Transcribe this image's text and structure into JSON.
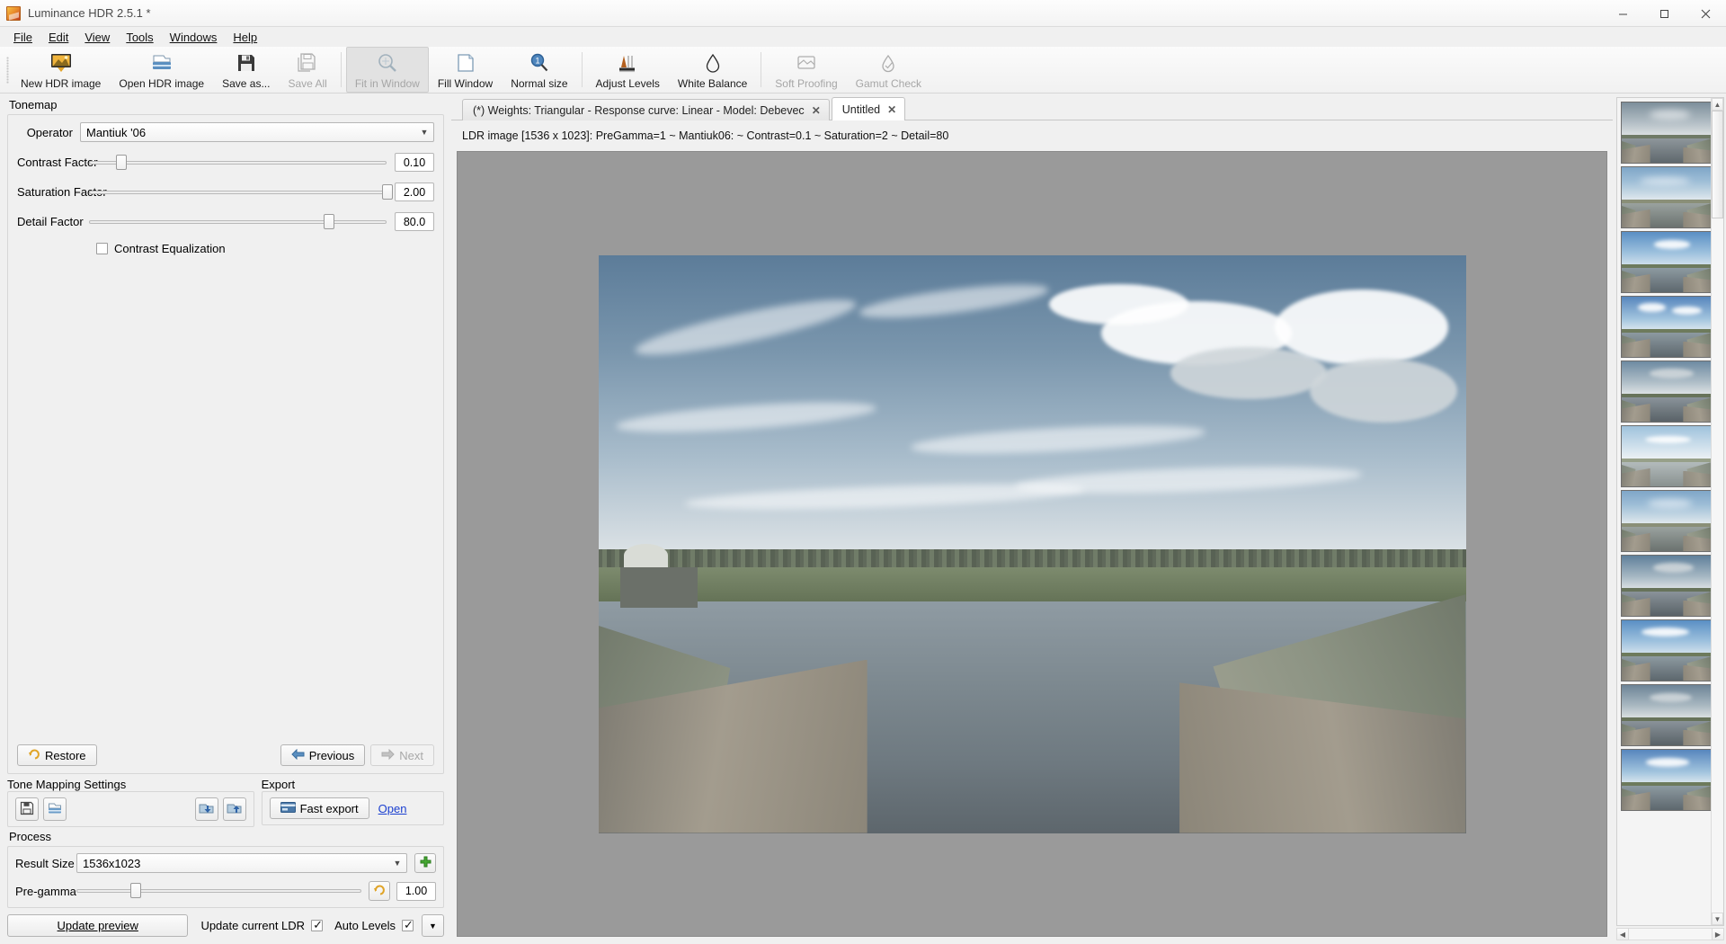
{
  "window": {
    "title": "Luminance HDR 2.5.1 *",
    "icon": "app-icon",
    "buttons": {
      "minimize": "—",
      "maximize": "❐",
      "close": "✕"
    }
  },
  "menubar": {
    "items": [
      {
        "label": "File",
        "mnemonic": "F"
      },
      {
        "label": "Edit",
        "mnemonic": "E"
      },
      {
        "label": "View",
        "mnemonic": "V"
      },
      {
        "label": "Tools",
        "mnemonic": "T"
      },
      {
        "label": "Windows",
        "mnemonic": "W"
      },
      {
        "label": "Help",
        "mnemonic": "H"
      }
    ]
  },
  "toolbar": {
    "buttons": [
      {
        "label": "New HDR image",
        "icon": "new-hdr-icon",
        "enabled": true,
        "checked": false
      },
      {
        "label": "Open HDR image",
        "icon": "open-folder-icon",
        "enabled": true,
        "checked": false
      },
      {
        "label": "Save as...",
        "icon": "floppy-disk-icon",
        "enabled": true,
        "checked": false
      },
      {
        "label": "Save All",
        "icon": "save-all-icon",
        "enabled": false,
        "checked": false
      },
      {
        "label": "Fit in Window",
        "icon": "fit-window-icon",
        "enabled": false,
        "checked": true
      },
      {
        "label": "Fill Window",
        "icon": "fill-window-icon",
        "enabled": true,
        "checked": false
      },
      {
        "label": "Normal size",
        "icon": "normal-size-icon",
        "enabled": true,
        "checked": false
      },
      {
        "label": "Adjust Levels",
        "icon": "histogram-icon",
        "enabled": true,
        "checked": false
      },
      {
        "label": "White Balance",
        "icon": "droplet-icon",
        "enabled": true,
        "checked": false
      },
      {
        "label": "Soft Proofing",
        "icon": "soft-proof-icon",
        "enabled": false,
        "checked": false
      },
      {
        "label": "Gamut Check",
        "icon": "gamut-check-icon",
        "enabled": false,
        "checked": false
      }
    ],
    "separator_after": [
      3,
      6
    ]
  },
  "tonemap": {
    "group_label": "Tonemap",
    "operator": {
      "label": "Operator",
      "value": "Mantiuk '06",
      "arrow": "▼"
    },
    "sliders": [
      {
        "label": "Contrast Factor",
        "value": "0.10",
        "percent": 9
      },
      {
        "label": "Saturation Factor",
        "value": "2.00",
        "percent": 99
      },
      {
        "label": "Detail Factor",
        "value": "80.0",
        "percent": 80
      }
    ],
    "checkbox": {
      "label": "Contrast Equalization",
      "checked": false
    },
    "restore_button": {
      "label": "Restore",
      "icon": "undo-arrow-icon",
      "enabled": true
    },
    "previous_button": {
      "label": "Previous",
      "icon": "left-arrow-icon",
      "enabled": true
    },
    "next_button": {
      "label": "Next",
      "icon": "right-arrow-icon",
      "enabled": false
    }
  },
  "tone_mapping_settings": {
    "group_label": "Tone Mapping Settings",
    "buttons": [
      {
        "icon": "save-settings-icon",
        "name": "save-settings-button"
      },
      {
        "icon": "load-settings-icon",
        "name": "load-settings-button"
      },
      {
        "icon": "import-settings-icon",
        "name": "import-settings-button"
      },
      {
        "icon": "export-settings-icon",
        "name": "export-settings-button"
      }
    ]
  },
  "export": {
    "group_label": "Export",
    "fast_export": {
      "label": "Fast export",
      "icon": "export-card-icon"
    },
    "open_link": "Open"
  },
  "process": {
    "group_label": "Process",
    "result_size": {
      "label": "Result Size",
      "value": "1536x1023",
      "arrow": "▼"
    },
    "add_size_button": {
      "icon": "plus-icon",
      "name": "add-size-button"
    },
    "pre_gamma": {
      "label": "Pre-gamma",
      "mnemonic": "g",
      "value": "1.00",
      "percent": 20,
      "reset_icon": "undo-arrow-icon"
    },
    "update_preview_button": {
      "label": "Update preview",
      "mnemonic": "U"
    },
    "update_current_ldr": {
      "label": "Update current LDR",
      "checked": true
    },
    "auto_levels": {
      "label": "Auto Levels",
      "checked": true
    },
    "options_arrow": "▼"
  },
  "tabs": [
    {
      "label": "(*) Weights: Triangular - Response curve: Linear - Model: Debevec",
      "close": "✕",
      "active": false
    },
    {
      "label": "Untitled",
      "close": "✕",
      "active": true
    }
  ],
  "status": {
    "text": "LDR image [1536 x 1023]: PreGamma=1 ~ Mantiuk06: ~ Contrast=0.1 ~ Saturation=2 ~ Detail=80"
  },
  "preview": {
    "name": "tonemapped-preview-image",
    "alt": "HDR tone mapped river lock photograph"
  },
  "thumbnails": {
    "count": 10,
    "items": [
      {
        "style": "hdr",
        "name": "thumbnail-0"
      },
      {
        "style": "flat",
        "name": "thumbnail-1"
      },
      {
        "style": "blue",
        "name": "thumbnail-2"
      },
      {
        "style": "blue",
        "name": "thumbnail-3"
      },
      {
        "style": "hdr",
        "name": "thumbnail-4"
      },
      {
        "style": "pale",
        "name": "thumbnail-5"
      },
      {
        "style": "flat",
        "name": "thumbnail-6"
      },
      {
        "style": "hdr",
        "name": "thumbnail-7"
      },
      {
        "style": "blue",
        "name": "thumbnail-8"
      },
      {
        "style": "hdr",
        "name": "thumbnail-9"
      },
      {
        "style": "blue",
        "name": "thumbnail-10"
      }
    ],
    "scroll_up": "▲",
    "scroll_down": "▼",
    "scroll_left": "◀",
    "scroll_right": "▶"
  },
  "colors": {
    "window_bg": "#f0f0f0",
    "canvas_bg": "#9a9a9a",
    "link": "#1a3fd0",
    "accent_blue": "#3c78b4",
    "title_text": "#4a4a4a"
  }
}
